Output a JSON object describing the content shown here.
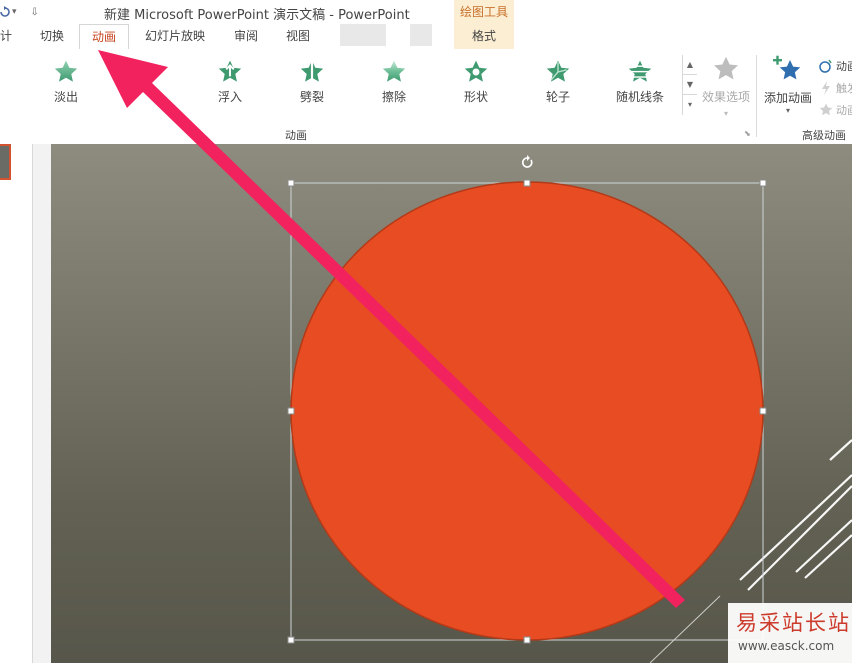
{
  "titlebar": {
    "title": "新建 Microsoft PowerPoint 演示文稿 - PowerPoint",
    "context_header": "绘图工具",
    "qat_icons": [
      "refresh-icon",
      "chevron-down-icon",
      "customize-icon"
    ]
  },
  "tabs": {
    "partial": "计",
    "items": [
      "切换",
      "动画",
      "幻灯片放映",
      "审阅",
      "视图"
    ],
    "active": "动画",
    "context_tab": "格式"
  },
  "ribbon": {
    "gallery": [
      {
        "label": "淡出",
        "icon": "fade-star-icon"
      },
      {
        "label": "浮入",
        "icon": "float-in-star-icon"
      },
      {
        "label": "劈裂",
        "icon": "split-star-icon"
      },
      {
        "label": "擦除",
        "icon": "wipe-star-icon"
      },
      {
        "label": "形状",
        "icon": "shape-star-icon"
      },
      {
        "label": "轮子",
        "icon": "wheel-star-icon"
      },
      {
        "label": "随机线条",
        "icon": "random-bars-star-icon"
      }
    ],
    "effects_options": "效果选项",
    "group_label": "动画",
    "add_animation": "添加动画",
    "advanced_items": [
      {
        "label": "动画",
        "icon": "animation-pane-icon"
      },
      {
        "label": "触发",
        "icon": "trigger-icon"
      },
      {
        "label": "动画",
        "icon": "animation-painter-icon"
      }
    ],
    "advanced_group_label": "高级动画"
  },
  "watermark": {
    "chinese": "易采站长站",
    "url": "www.easck.com"
  },
  "colors": {
    "accent_tab": "#c7451f",
    "circle_fill": "#e84c22",
    "arrow": "#f2225f",
    "star_green": "#3f9a70",
    "context_bg": "#fbeed2"
  }
}
